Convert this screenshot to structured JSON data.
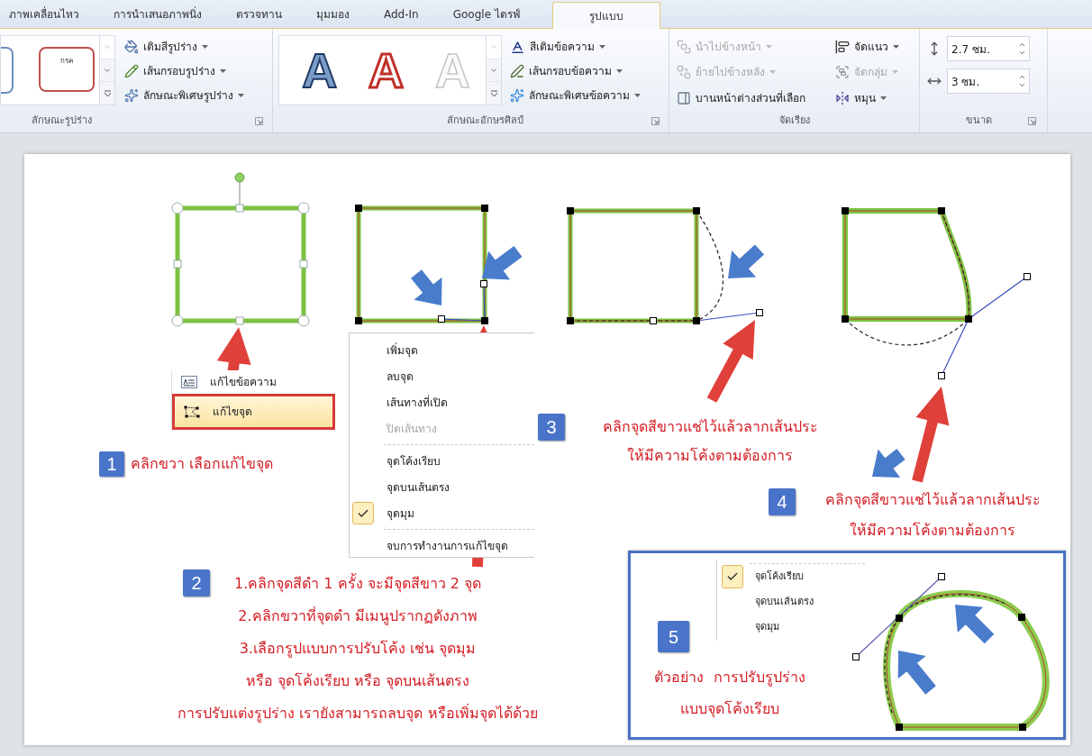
{
  "ribbon": {
    "tabs": [
      {
        "label": "ภาพเคลื่อนไหว",
        "selected": false
      },
      {
        "label": "การนำเสนอภาพนิ่ง",
        "selected": false
      },
      {
        "label": "ตรวจทาน",
        "selected": false
      },
      {
        "label": "มุมมอง",
        "selected": false
      },
      {
        "label": "Add-In",
        "selected": false
      },
      {
        "label": "Google ไดรฟ์",
        "selected": false
      },
      {
        "label": "รูปแบบ",
        "selected": true
      }
    ],
    "shape_styles": {
      "sample": "กรค",
      "commands": [
        {
          "label": "เติมสีรูปร่าง",
          "dropdown": true
        },
        {
          "label": "เส้นกรอบรูปร่าง",
          "dropdown": true
        },
        {
          "label": "ลักษณะพิเศษรูปร่าง",
          "dropdown": true
        }
      ],
      "label": "ลักษณะรูปร่าง"
    },
    "wordart_styles": {
      "samples": [
        {
          "text": "A",
          "kind": "outline"
        },
        {
          "text": "A",
          "kind": "fill"
        },
        {
          "text": "A",
          "kind": "faint"
        }
      ],
      "commands": [
        {
          "label": "สีเติมข้อความ",
          "dropdown": true
        },
        {
          "label": "เส้นกรอบข้อความ",
          "dropdown": true
        },
        {
          "label": "ลักษณะพิเศษข้อความ",
          "dropdown": true
        }
      ],
      "label": "ลักษณะอักษรศิลป์"
    },
    "arrange": {
      "commands": [
        {
          "label": "นำไปข้างหน้า",
          "dropdown": true,
          "disabled": true
        },
        {
          "label": "ย้ายไปข้างหลัง",
          "dropdown": true,
          "disabled": true
        },
        {
          "label": "บานหน้าต่างส่วนที่เลือก",
          "dropdown": false,
          "disabled": false
        },
        {
          "label": "จัดแนว",
          "dropdown": true,
          "disabled": false
        },
        {
          "label": "จัดกลุ่ม",
          "dropdown": true,
          "disabled": true
        },
        {
          "label": "หมุน",
          "dropdown": true,
          "disabled": false
        }
      ],
      "label": "จัดเรียง"
    },
    "size": {
      "height": "2.7 ซม.",
      "width": "3 ซม.",
      "label": "ขนาด"
    }
  },
  "slide": {
    "shape_menu": [
      {
        "label": "แก้ไขข้อความ",
        "selected": false
      },
      {
        "label": "แก้ไขจุด",
        "selected": true
      }
    ],
    "point_menu": [
      [
        {
          "label": "เพิ่มจุด",
          "disabled": false,
          "checked": false
        },
        {
          "label": "ลบจุด",
          "disabled": false,
          "checked": false
        },
        {
          "label": "เส้นทางที่เปิด",
          "disabled": false,
          "checked": false
        },
        {
          "label": "ปิดเส้นทาง",
          "disabled": true,
          "checked": false
        }
      ],
      [
        {
          "label": "จุดโค้งเรียบ",
          "disabled": false,
          "checked": false
        },
        {
          "label": "จุดบนเส้นตรง",
          "disabled": false,
          "checked": false
        },
        {
          "label": "จุดมุม",
          "disabled": false,
          "checked": true
        }
      ],
      [
        {
          "label": "จบการทำงานการแก้ไขจุด",
          "disabled": false,
          "checked": false
        }
      ]
    ],
    "example_menu": [
      {
        "label": "จุดโค้งเรียบ",
        "checked": true
      },
      {
        "label": "จุดบนเส้นตรง",
        "checked": false
      },
      {
        "label": "จุดมุม",
        "checked": false
      }
    ],
    "steps": [
      {
        "number": "1",
        "lines": [
          "คลิกขวา เลือกแก้ไขจุด"
        ]
      },
      {
        "number": "2",
        "lines": [
          "1.คลิกจุดสีดำ 1 ครั้ง จะมีจุดสีขาว 2 จุด",
          "2.คลิกขวาที่จุดดำ มีเมนูปรากฏดังภาพ",
          "3.เลือกรูปแบบการปรับโค้ง เช่น จุดมุม",
          "หรือ จุดโค้งเรียบ หรือ จุดบนเส้นตรง",
          "การปรับแต่งรูปร่าง เรายังสามารถลบจุด หรือเพิ่มจุดได้ด้วย"
        ]
      },
      {
        "number": "3",
        "lines": [
          "คลิกจุดสีขาวแช่ไว้แล้วลากเส้นประ",
          "ให้มีความโค้งตามต้องการ"
        ]
      },
      {
        "number": "4",
        "lines": [
          "คลิกจุดสีขาวแช่ไว้แล้วลากเส้นประ",
          "ให้มีความโค้งตามต้องการ"
        ]
      },
      {
        "number": "5",
        "lines": [
          "ตัวอย่าง  การปรับรูปร่าง",
          "แบบจุดโค้งเรียบ"
        ]
      }
    ]
  }
}
